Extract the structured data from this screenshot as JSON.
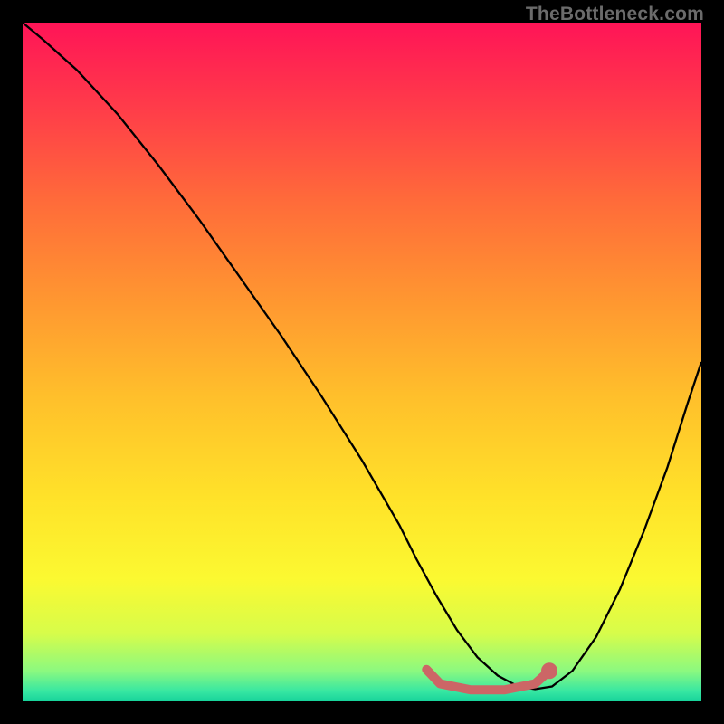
{
  "watermark": "TheBottleneck.com",
  "chart_data": {
    "type": "line",
    "title": "",
    "xlabel": "",
    "ylabel": "",
    "xlim": [
      0,
      100
    ],
    "ylim": [
      0,
      100
    ],
    "grid": false,
    "annotations": [],
    "background_gradient_stops": [
      {
        "pos": 0.0,
        "color": "#ff1457"
      },
      {
        "pos": 0.12,
        "color": "#ff3a4a"
      },
      {
        "pos": 0.26,
        "color": "#ff6a3a"
      },
      {
        "pos": 0.4,
        "color": "#ff9431"
      },
      {
        "pos": 0.55,
        "color": "#ffbf2b"
      },
      {
        "pos": 0.7,
        "color": "#ffe229"
      },
      {
        "pos": 0.82,
        "color": "#fbf931"
      },
      {
        "pos": 0.9,
        "color": "#d7fc4a"
      },
      {
        "pos": 0.955,
        "color": "#8cf97f"
      },
      {
        "pos": 0.985,
        "color": "#37e7a2"
      },
      {
        "pos": 1.0,
        "color": "#17d39b"
      }
    ],
    "series": [
      {
        "name": "bottleneck-curve",
        "stroke": "#000000",
        "stroke_width": 2.3,
        "x": [
          0,
          3,
          8,
          14,
          20,
          26,
          32,
          38,
          44,
          50,
          55.5,
          58,
          61,
          64,
          67,
          70,
          73,
          75.5,
          78,
          81,
          84.5,
          88,
          91.5,
          95,
          98,
          100
        ],
        "y": [
          100,
          97.5,
          93,
          86.5,
          79,
          71,
          62.5,
          54,
          45,
          35.5,
          26,
          21,
          15.5,
          10.5,
          6.5,
          3.8,
          2.2,
          1.8,
          2.2,
          4.5,
          9.5,
          16.5,
          25,
          34.5,
          44,
          50
        ]
      },
      {
        "name": "flat-zone-marker",
        "stroke": "#cc6666",
        "stroke_width": 10,
        "linecap": "round",
        "x": [
          59.5,
          61.5,
          66,
          71,
          75.5,
          77.5
        ],
        "y": [
          4.7,
          2.6,
          1.7,
          1.7,
          2.6,
          4.4
        ]
      }
    ],
    "markers": [
      {
        "name": "flat-zone-end-dot",
        "x": 77.6,
        "y": 4.5,
        "r": 1.2,
        "fill": "#cc6666"
      }
    ]
  }
}
